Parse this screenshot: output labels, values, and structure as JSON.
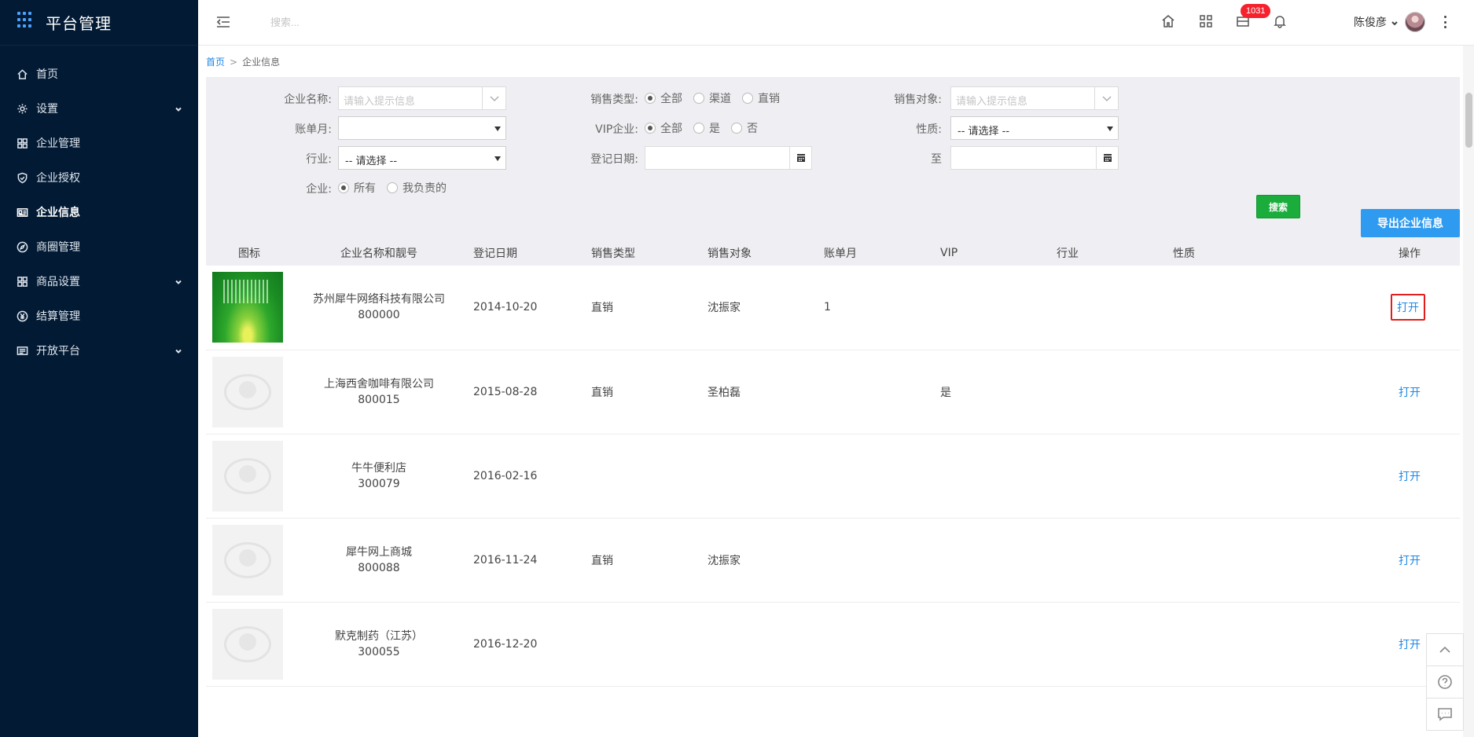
{
  "app": {
    "title": "平台管理"
  },
  "sidebar": {
    "items": [
      {
        "label": "首页",
        "icon": "home-icon",
        "expandable": false,
        "active": false
      },
      {
        "label": "设置",
        "icon": "gear-icon",
        "expandable": true,
        "active": false
      },
      {
        "label": "企业管理",
        "icon": "grid-apps-icon",
        "expandable": false,
        "active": false
      },
      {
        "label": "企业授权",
        "icon": "shield-check-icon",
        "expandable": false,
        "active": false
      },
      {
        "label": "企业信息",
        "icon": "id-card-icon",
        "expandable": false,
        "active": true
      },
      {
        "label": "商圈管理",
        "icon": "compass-icon",
        "expandable": false,
        "active": false
      },
      {
        "label": "商品设置",
        "icon": "grid-apps-icon",
        "expandable": true,
        "active": false
      },
      {
        "label": "结算管理",
        "icon": "yuan-coin-icon",
        "expandable": false,
        "active": false
      },
      {
        "label": "开放平台",
        "icon": "newspaper-icon",
        "expandable": true,
        "active": false
      }
    ]
  },
  "topbar": {
    "search_placeholder": "搜索...",
    "badge_count": "1031",
    "user_name": "陈俊彦"
  },
  "breadcrumb": {
    "home": "首页",
    "separator": ">",
    "current": "企业信息"
  },
  "filters": {
    "company_name": {
      "label": "企业名称:",
      "placeholder": "请输入提示信息"
    },
    "sales_type": {
      "label": "销售类型:",
      "options": [
        "全部",
        "渠道",
        "直销"
      ],
      "selected": "全部"
    },
    "sales_target": {
      "label": "销售对象:",
      "placeholder": "请输入提示信息"
    },
    "bill_month": {
      "label": "账单月:",
      "value": ""
    },
    "vip": {
      "label": "VIP企业:",
      "options": [
        "全部",
        "是",
        "否"
      ],
      "selected": "全部"
    },
    "nature": {
      "label": "性质:",
      "value": "-- 请选择 --"
    },
    "industry": {
      "label": "行业:",
      "value": "-- 请选择 --"
    },
    "reg_date": {
      "label": "登记日期:",
      "to_label": "至"
    },
    "company_scope": {
      "label": "企业:",
      "options": [
        "所有",
        "我负责的"
      ],
      "selected": "所有"
    },
    "search_button": "搜索"
  },
  "export_button": "导出企业信息",
  "table": {
    "headers": [
      "图标",
      "企业名称和靓号",
      "登记日期",
      "销售类型",
      "销售对象",
      "账单月",
      "VIP",
      "行业",
      "性质",
      "操作"
    ],
    "rows": [
      {
        "thumb": "green",
        "name": "苏州犀牛网络科技有限公司",
        "code": "800000",
        "date": "2014-10-20",
        "sales_type": "直销",
        "sales_target": "沈振家",
        "bill_month": "1",
        "vip": "",
        "industry": "",
        "nature": "",
        "action": "打开",
        "highlight": true
      },
      {
        "thumb": "placeholder",
        "name": "上海西舍咖啡有限公司",
        "code": "800015",
        "date": "2015-08-28",
        "sales_type": "直销",
        "sales_target": "圣柏磊",
        "bill_month": "",
        "vip": "是",
        "industry": "",
        "nature": "",
        "action": "打开",
        "highlight": false
      },
      {
        "thumb": "placeholder",
        "name": "牛牛便利店",
        "code": "300079",
        "date": "2016-02-16",
        "sales_type": "",
        "sales_target": "",
        "bill_month": "",
        "vip": "",
        "industry": "",
        "nature": "",
        "action": "打开",
        "highlight": false
      },
      {
        "thumb": "placeholder",
        "name": "犀牛网上商城",
        "code": "800088",
        "date": "2016-11-24",
        "sales_type": "直销",
        "sales_target": "沈振家",
        "bill_month": "",
        "vip": "",
        "industry": "",
        "nature": "",
        "action": "打开",
        "highlight": false
      },
      {
        "thumb": "placeholder",
        "name": "默克制药（江苏）",
        "code": "300055",
        "date": "2016-12-20",
        "sales_type": "",
        "sales_target": "",
        "bill_month": "",
        "vip": "",
        "industry": "",
        "nature": "",
        "action": "打开",
        "highlight": false
      }
    ]
  },
  "colors": {
    "sidebar_bg": "#021a33",
    "accent_blue": "#2e9bf0",
    "search_green": "#1aad3c",
    "badge_red": "#f5222d",
    "highlight_red": "#e21d1d"
  }
}
